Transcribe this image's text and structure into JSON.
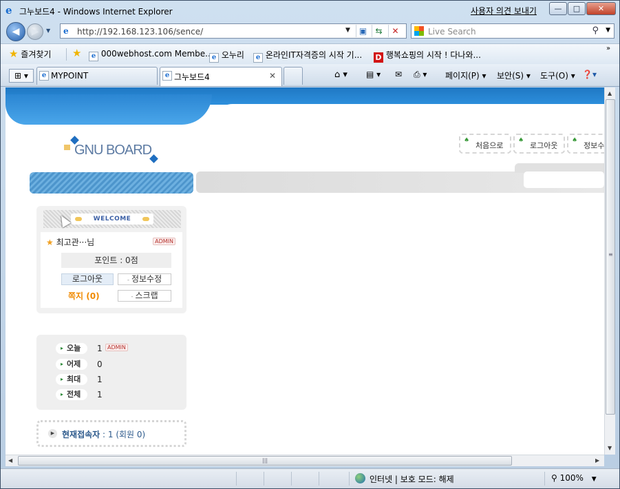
{
  "window": {
    "title": "그누보드4 - Windows Internet Explorer",
    "feedback": "사용자 의견 보내기",
    "min": "—",
    "max": "□",
    "close": "✕"
  },
  "address": {
    "url": "http://192.168.123.106/sence/",
    "search_placeholder": "Live Search"
  },
  "favorites": {
    "label": "즐겨찾기",
    "items": [
      "000webhost.com Membe...",
      "오누리",
      "온라인IT자격증의 시작 기...",
      "행복쇼핑의 시작 ! 다나와..."
    ],
    "more": "»"
  },
  "tabs": [
    {
      "label": "MYPOINT"
    },
    {
      "label": "그누보드4"
    }
  ],
  "commands": {
    "page": "페이지(P)",
    "security": "보안(S)",
    "tools": "도구(O)"
  },
  "site": {
    "logo": "GNU BOARD",
    "top_buttons": [
      "처음으로",
      "로그아웃",
      "정보수"
    ],
    "welcome": "WELCOME",
    "user": {
      "name": "최고관···님",
      "badge": "ADMIN",
      "points": "포인트 : 0점",
      "logout": "로그아웃",
      "edit": "정보수정",
      "memo": "쪽지 (0)",
      "scrap": "스크랩"
    },
    "visits": [
      {
        "label": "오늘",
        "value": "1",
        "badge": "ADMIN"
      },
      {
        "label": "어제",
        "value": "0"
      },
      {
        "label": "최대",
        "value": "1"
      },
      {
        "label": "전체",
        "value": "1"
      }
    ],
    "current_users": {
      "label": "현재접속자",
      "value": " : 1 (회원 0)"
    }
  },
  "status": {
    "zone": "인터넷 | 보호 모드: 해제",
    "zoom": "100%"
  },
  "colors": {
    "brand_blue": "#2d8fdc",
    "memo_orange": "#f08a00",
    "admin_red": "#b5302a"
  }
}
